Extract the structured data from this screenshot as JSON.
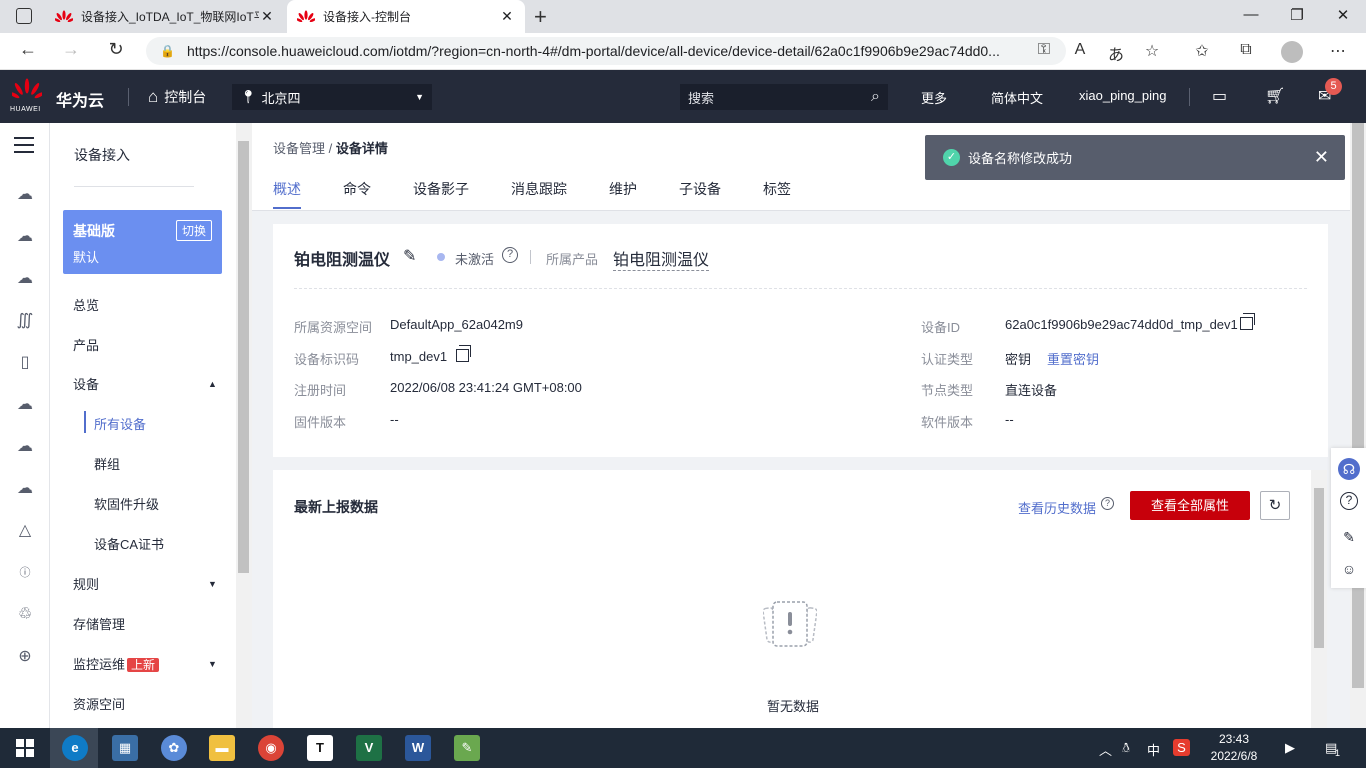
{
  "browser": {
    "tabs": [
      {
        "title": "设备接入_IoTDA_IoT_物联网IoT平",
        "active": false
      },
      {
        "title": "设备接入-控制台",
        "active": true
      }
    ],
    "url": "https://console.huaweicloud.com/iotdm/?region=cn-north-4#/dm-portal/device/all-device/device-detail/62a0c1f9906b9e29ac74dd0..."
  },
  "topnav": {
    "logo_text": "HUAWEI",
    "brand": "华为云",
    "console": "控制台",
    "region": "北京四",
    "search_placeholder": "搜索",
    "more": "更多",
    "language": "简体中文",
    "username": "xiao_ping_ping",
    "message_count": "5"
  },
  "sidemenu": {
    "title": "设备接入",
    "edition": {
      "name": "基础版",
      "sub": "默认",
      "switch": "切换"
    },
    "items": {
      "overview": "总览",
      "product": "产品",
      "device": "设备",
      "all_devices": "所有设备",
      "groups": "群组",
      "firmware": "软固件升级",
      "ca_cert": "设备CA证书",
      "rules": "规则",
      "storage": "存储管理",
      "monitoring": "监控运维",
      "monitoring_badge": "上新",
      "resource_space": "资源空间"
    }
  },
  "breadcrumb": {
    "parent": "设备管理",
    "sep": " / ",
    "current": "设备详情"
  },
  "tabs": [
    "概述",
    "命令",
    "设备影子",
    "消息跟踪",
    "维护",
    "子设备",
    "标签"
  ],
  "device": {
    "name": "铂电阻测温仪",
    "status": "未激活",
    "product_label": "所属产品",
    "product_value": "铂电阻测温仪",
    "fields_left": [
      {
        "label": "所属资源空间",
        "value": "DefaultApp_62a042m9"
      },
      {
        "label": "设备标识码",
        "value": "tmp_dev1"
      },
      {
        "label": "注册时间",
        "value": "2022/06/08 23:41:24 GMT+08:00"
      },
      {
        "label": "固件版本",
        "value": "--"
      }
    ],
    "fields_right": [
      {
        "label": "设备ID",
        "value": "62a0c1f9906b9e29ac74dd0d_tmp_dev1"
      },
      {
        "label": "认证类型",
        "value": "密钥"
      },
      {
        "label": "节点类型",
        "value": "直连设备"
      },
      {
        "label": "软件版本",
        "value": "--"
      }
    ],
    "reset_key": "重置密钥"
  },
  "report": {
    "title": "最新上报数据",
    "history_link": "查看历史数据",
    "view_all": "查看全部属性",
    "empty": "暂无数据"
  },
  "toast": {
    "message": "设备名称修改成功"
  },
  "taskbar": {
    "time": "23:43",
    "date": "2022/6/8",
    "ime": "中",
    "notif_count": "1"
  },
  "colors": {
    "primary": "#526ecc",
    "danger": "#c7000b",
    "nav": "#252b3a",
    "success": "#50d4ab"
  }
}
